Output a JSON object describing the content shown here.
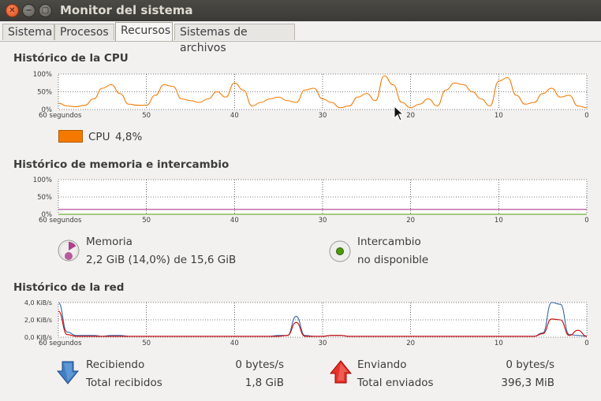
{
  "window": {
    "title": "Monitor del sistema"
  },
  "tabs": [
    {
      "label": "Sistema"
    },
    {
      "label": "Procesos"
    },
    {
      "label": "Recursos"
    },
    {
      "label": "Sistemas de archivos"
    }
  ],
  "cpu": {
    "section_title": "Histórico de la CPU",
    "y_ticks": [
      "100%",
      "50%",
      "0%"
    ],
    "x_ticks": [
      "60 segundos",
      "50",
      "40",
      "30",
      "20",
      "10",
      "0"
    ],
    "legend_label": "CPU",
    "legend_value": "4,8%",
    "color": "#f57900"
  },
  "memory": {
    "section_title": "Histórico de memoria e intercambio",
    "y_ticks": [
      "100%",
      "50%",
      "0%"
    ],
    "x_ticks": [
      "60 segundos",
      "50",
      "40",
      "30",
      "20",
      "10",
      "0"
    ],
    "mem_label": "Memoria",
    "mem_value": "2,2 GiB (14,0%) de 15,6 GiB",
    "swap_label": "Intercambio",
    "swap_value": "no disponible",
    "mem_color": "#ad3f8d",
    "swap_color": "#4e9a06"
  },
  "network": {
    "section_title": "Histórico de la red",
    "y_ticks": [
      "4,0 KiB/s",
      "2,0 KiB/s",
      "0,0 KiB/s"
    ],
    "x_ticks": [
      "60 segundos",
      "50",
      "40",
      "30",
      "20",
      "10",
      "0"
    ],
    "receiving_label": "Recibiendo",
    "receiving_value": "0 bytes/s",
    "total_received_label": "Total recibidos",
    "total_received_value": "1,8 GiB",
    "sending_label": "Enviando",
    "sending_value": "0 bytes/s",
    "total_sent_label": "Total enviados",
    "total_sent_value": "396,3 MiB",
    "recv_color": "#3465a4",
    "send_color": "#cc0000"
  },
  "chart_data": [
    {
      "type": "line",
      "title": "Histórico de la CPU",
      "x": [
        60,
        59,
        58,
        57,
        56,
        55,
        54,
        53,
        52,
        51,
        50,
        49,
        48,
        47,
        46,
        45,
        44,
        43,
        42,
        41,
        40,
        39,
        38,
        37,
        36,
        35,
        34,
        33,
        32,
        31,
        30,
        29,
        28,
        27,
        26,
        25,
        24,
        23,
        22,
        21,
        20,
        19,
        18,
        17,
        16,
        15,
        14,
        13,
        12,
        11,
        10,
        9,
        8,
        7,
        6,
        5,
        4,
        3,
        2,
        1,
        0
      ],
      "series": [
        {
          "name": "CPU",
          "values": [
            18,
            10,
            8,
            12,
            30,
            60,
            70,
            45,
            15,
            12,
            12,
            40,
            70,
            65,
            30,
            25,
            20,
            30,
            50,
            35,
            75,
            55,
            10,
            20,
            30,
            35,
            25,
            20,
            55,
            60,
            30,
            20,
            5,
            10,
            35,
            45,
            25,
            95,
            70,
            20,
            5,
            15,
            30,
            10,
            55,
            75,
            70,
            50,
            30,
            10,
            80,
            90,
            40,
            15,
            20,
            45,
            60,
            35,
            40,
            10,
            5
          ]
        }
      ],
      "xlabel": "segundos",
      "ylim": [
        0,
        100
      ]
    },
    {
      "type": "line",
      "title": "Histórico de memoria e intercambio",
      "x": [
        60,
        0
      ],
      "series": [
        {
          "name": "Memoria",
          "values": [
            14.0,
            14.0
          ]
        },
        {
          "name": "Intercambio",
          "values": [
            0,
            0
          ]
        }
      ],
      "ylim": [
        0,
        100
      ]
    },
    {
      "type": "line",
      "title": "Histórico de la red",
      "x": [
        60,
        59,
        58,
        57,
        56,
        55,
        54,
        53,
        52,
        51,
        50,
        49,
        48,
        47,
        46,
        45,
        44,
        43,
        42,
        41,
        40,
        39,
        38,
        37,
        36,
        35,
        34,
        33,
        32,
        31,
        30,
        29,
        28,
        27,
        26,
        25,
        24,
        23,
        22,
        21,
        20,
        19,
        18,
        17,
        16,
        15,
        14,
        13,
        12,
        11,
        10,
        9,
        8,
        7,
        6,
        5,
        4,
        3,
        2,
        1,
        0
      ],
      "series": [
        {
          "name": "Recibiendo",
          "values": [
            4.0,
            0.6,
            0.2,
            0.2,
            0.2,
            0.1,
            0.2,
            0.2,
            0.1,
            0.1,
            0.1,
            0.1,
            0.1,
            0.1,
            0.1,
            0.1,
            0.1,
            0.1,
            0.1,
            0.1,
            0.1,
            0.1,
            0.1,
            0.1,
            0.1,
            0.2,
            0.2,
            2.4,
            0.2,
            0.1,
            0.1,
            0.2,
            0.2,
            0.1,
            0.1,
            0.1,
            0.1,
            0.1,
            0.1,
            0.1,
            0.1,
            0.1,
            0.1,
            0.1,
            0.1,
            0.1,
            0.1,
            0.1,
            0.1,
            0.1,
            0.1,
            0.1,
            0.1,
            0.1,
            0.1,
            0.5,
            4.0,
            3.8,
            0.3,
            0.2,
            0.1
          ]
        },
        {
          "name": "Enviando",
          "values": [
            3.0,
            0.3,
            0.1,
            0.1,
            0.1,
            0.1,
            0.1,
            0.1,
            0.1,
            0.1,
            0.1,
            0.1,
            0.1,
            0.1,
            0.1,
            0.1,
            0.1,
            0.1,
            0.1,
            0.1,
            0.1,
            0.1,
            0.1,
            0.1,
            0.1,
            0.1,
            0.2,
            1.7,
            0.1,
            0.1,
            0.1,
            0.2,
            0.2,
            0.1,
            0.1,
            0.1,
            0.1,
            0.1,
            0.1,
            0.1,
            0.1,
            0.1,
            0.1,
            0.1,
            0.1,
            0.1,
            0.1,
            0.1,
            0.1,
            0.1,
            0.1,
            0.1,
            0.1,
            0.1,
            0.1,
            0.4,
            2.1,
            2.0,
            0.2,
            0.8,
            0.1
          ]
        }
      ],
      "ylim": [
        0,
        4.0
      ]
    }
  ]
}
